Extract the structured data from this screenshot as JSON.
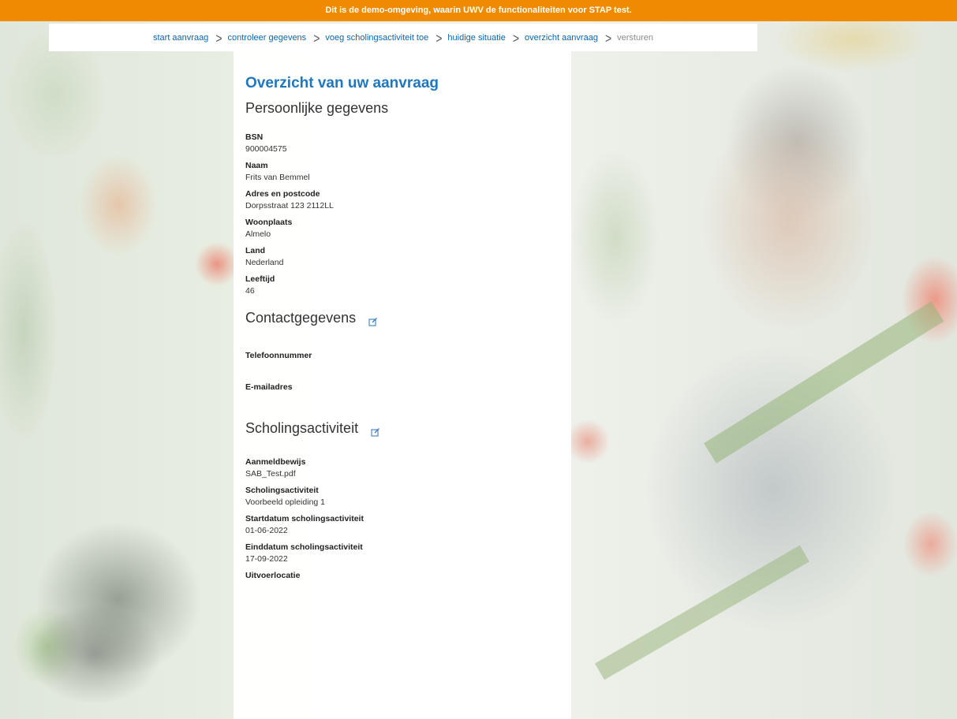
{
  "banner": {
    "text": "Dit is de demo-omgeving, waarin UWV de functionaliteiten voor STAP test."
  },
  "breadcrumb": {
    "items": [
      {
        "label": "start aanvraag"
      },
      {
        "label": "controleer gegevens"
      },
      {
        "label": "voeg scholingsactiviteit toe"
      },
      {
        "label": "huidige situatie"
      },
      {
        "label": "overzicht aanvraag"
      },
      {
        "label": "versturen"
      }
    ]
  },
  "page": {
    "title": "Overzicht van uw aanvraag"
  },
  "personal": {
    "title": "Persoonlijke gegevens",
    "fields": [
      {
        "label": "BSN",
        "value": "900004575"
      },
      {
        "label": "Naam",
        "value": "Frits van Bemmel"
      },
      {
        "label": "Adres en postcode",
        "value": "Dorpsstraat 123 2112LL"
      },
      {
        "label": "Woonplaats",
        "value": "Almelo"
      },
      {
        "label": "Land",
        "value": "Nederland"
      },
      {
        "label": "Leeftijd",
        "value": "46"
      }
    ]
  },
  "contact": {
    "title": "Contactgegevens",
    "fields": [
      {
        "label": "Telefoonnummer",
        "value": ""
      },
      {
        "label": "E-mailadres",
        "value": ""
      }
    ]
  },
  "training": {
    "title": "Scholingsactiviteit",
    "fields": [
      {
        "label": "Aanmeldbewijs",
        "value": "SAB_Test.pdf"
      },
      {
        "label": "Scholingsactiviteit",
        "value": "Voorbeeld opleiding 1"
      },
      {
        "label": "Startdatum scholingsactiviteit",
        "value": "01-06-2022"
      },
      {
        "label": "Einddatum scholingsactiviteit",
        "value": "17-09-2022"
      },
      {
        "label": "Uitvoerlocatie",
        "value": ""
      }
    ]
  },
  "colors": {
    "banner": "#f08a00",
    "link": "#0a65b0",
    "title": "#1f77c0"
  }
}
